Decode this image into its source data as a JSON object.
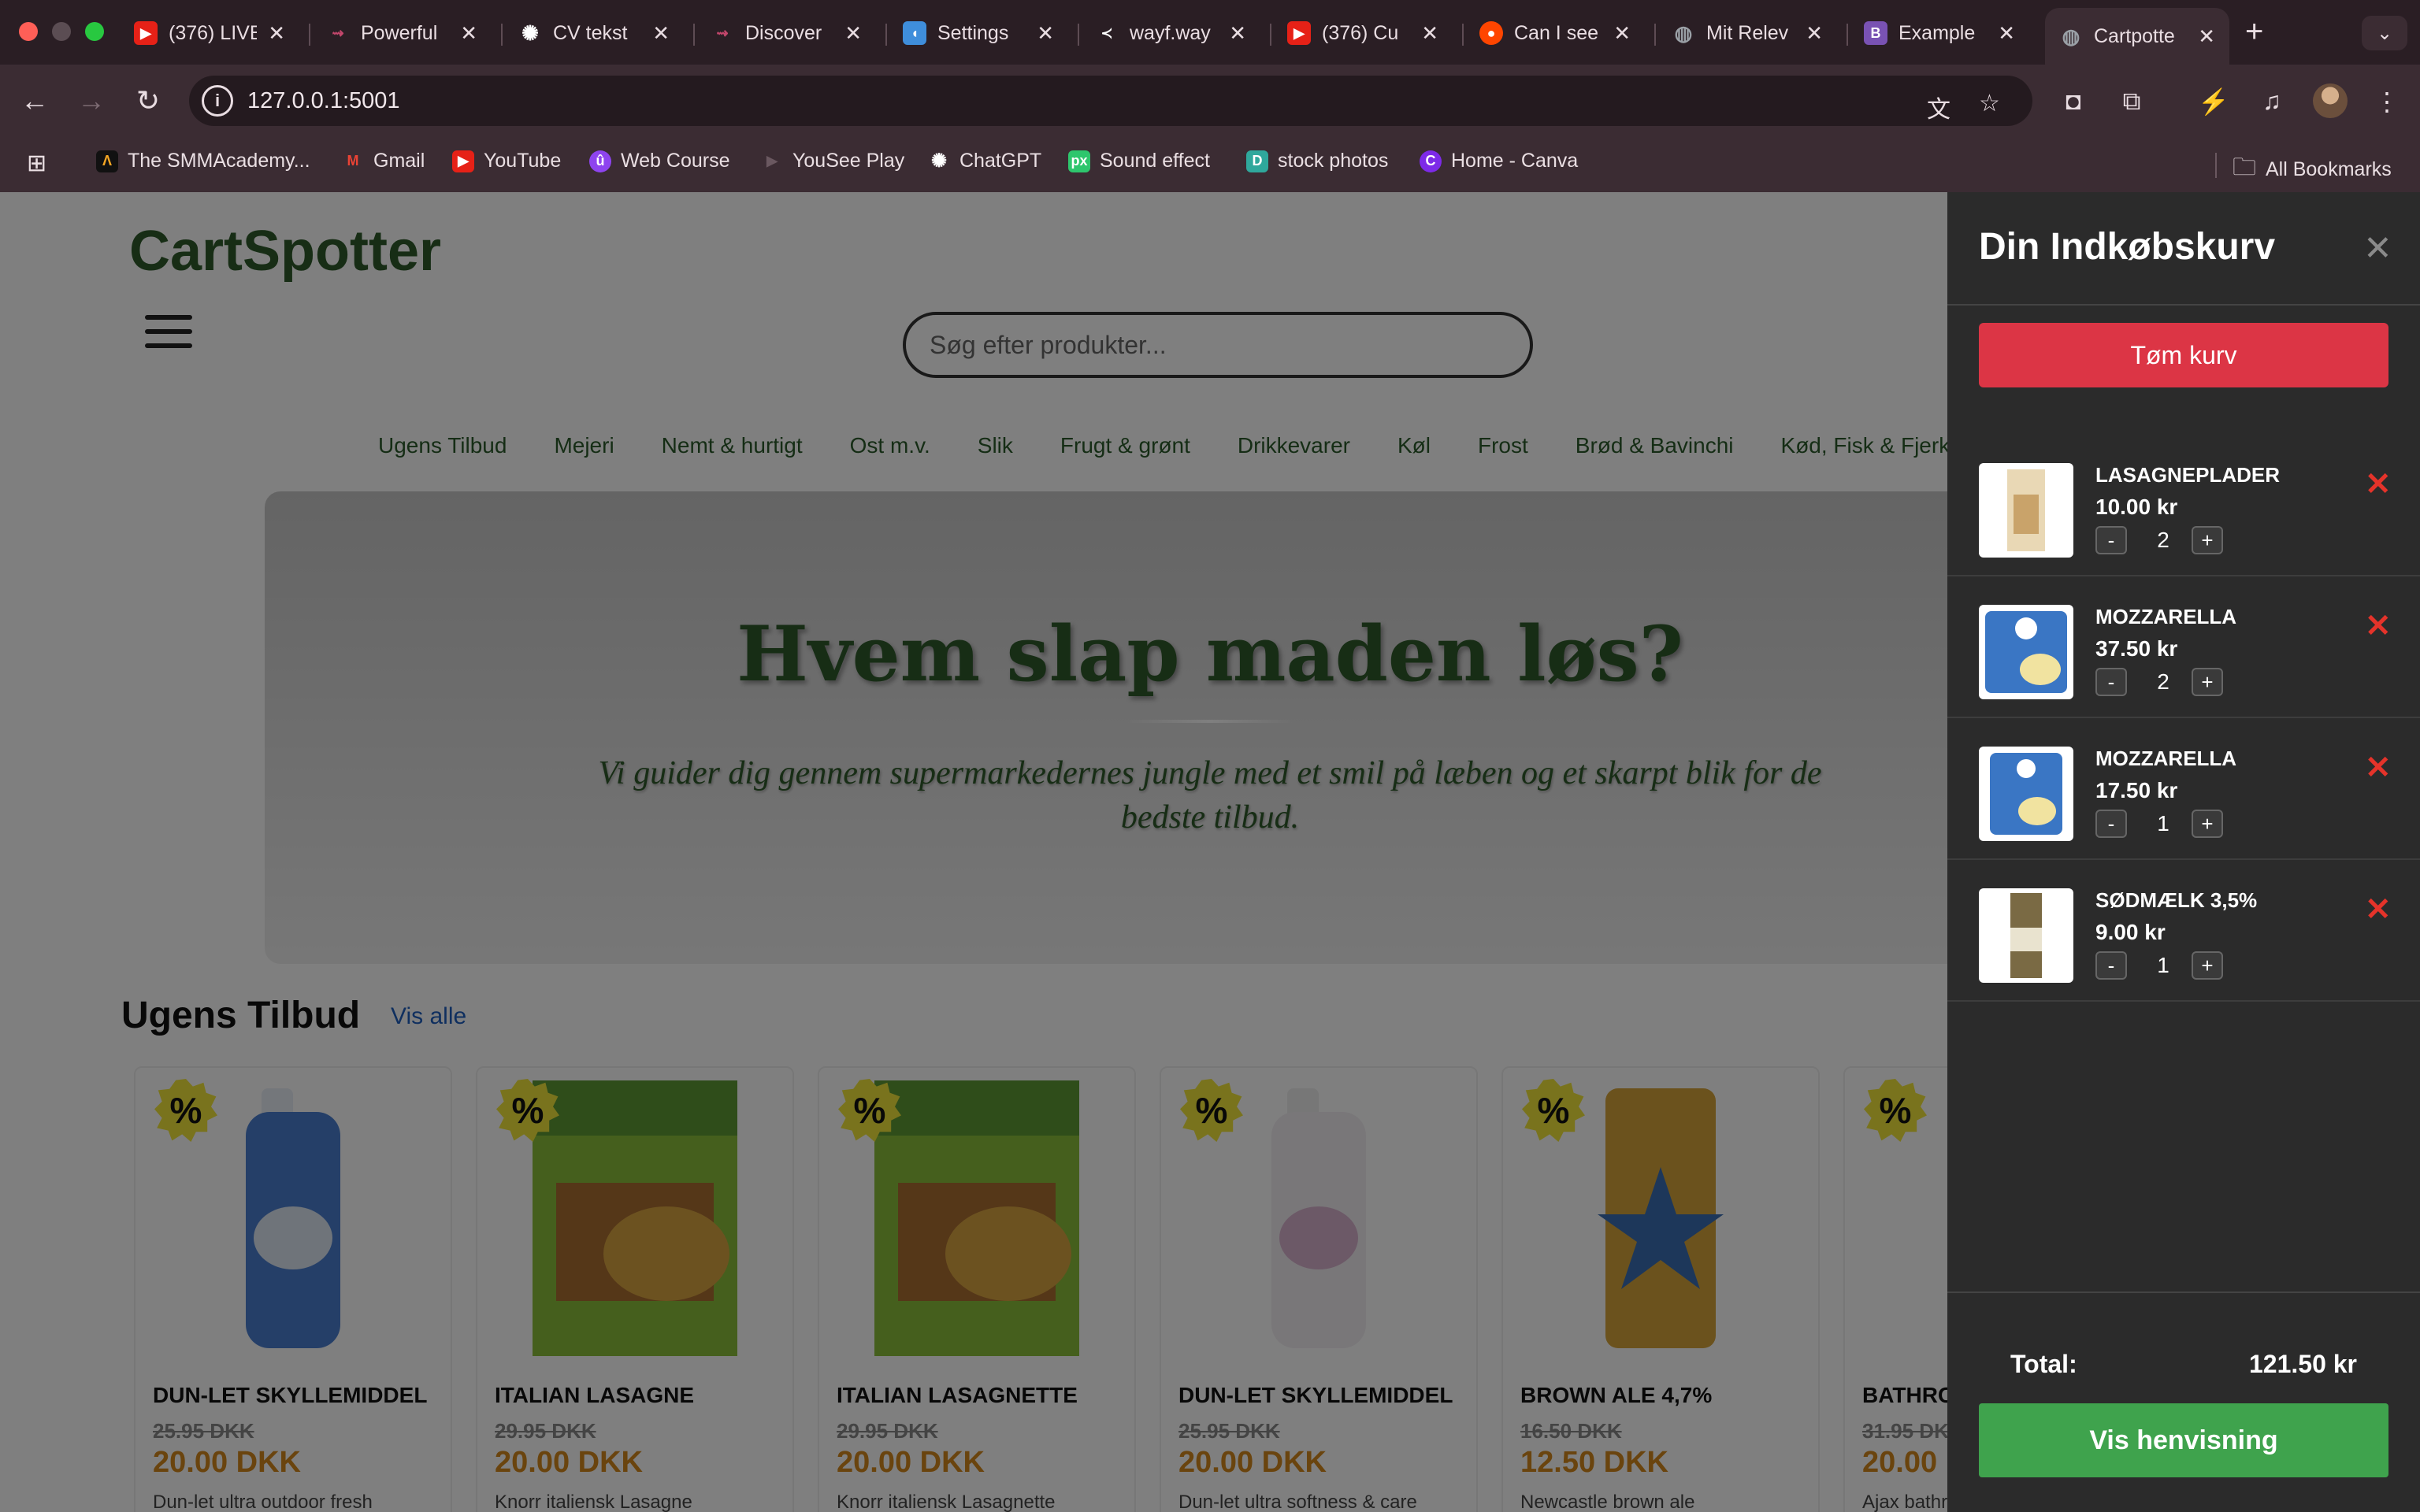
{
  "browser": {
    "tabs": [
      {
        "title": "(376) LIVE",
        "icon": "youtube-icon",
        "color": "#e62117"
      },
      {
        "title": "Powerful",
        "icon": "link-icon",
        "color": "#c2466b"
      },
      {
        "title": "CV tekst",
        "icon": "openai-icon",
        "color": "#ffffff"
      },
      {
        "title": "Discover",
        "icon": "link-icon",
        "color": "#c2466b"
      },
      {
        "title": "Settings",
        "icon": "settings-app-icon",
        "color": "#3f8edb"
      },
      {
        "title": "wayf.way",
        "icon": "wayf-icon",
        "color": "#ffffff"
      },
      {
        "title": "(376) Cu",
        "icon": "youtube-icon",
        "color": "#e62117"
      },
      {
        "title": "Can I see",
        "icon": "reddit-icon",
        "color": "#ff4500"
      },
      {
        "title": "Mit Relev",
        "icon": "globe-icon",
        "color": "#9aa0a6"
      },
      {
        "title": "Example",
        "icon": "bootstrap-icon",
        "color": "#7952b3"
      },
      {
        "title": "Cartpotte",
        "icon": "globe-icon",
        "color": "#9aa0a6",
        "active": true
      }
    ],
    "url": "127.0.0.1:5001",
    "bookmarks": [
      {
        "label": "The SMMAcademy...",
        "icon": "smm-icon",
        "color": "#f5a623"
      },
      {
        "label": "Gmail",
        "icon": "gmail-icon",
        "color": "#ea4335"
      },
      {
        "label": "YouTube",
        "icon": "youtube-icon",
        "color": "#e62117"
      },
      {
        "label": "Web Course",
        "icon": "course-icon",
        "color": "#8e44ef"
      },
      {
        "label": "YouSee Play",
        "icon": "play-icon",
        "color": "#3b2c33"
      },
      {
        "label": "ChatGPT",
        "icon": "openai-icon",
        "color": "#ffffff"
      },
      {
        "label": "Sound effect",
        "icon": "pixabay-icon",
        "color": "#2ec66d"
      },
      {
        "label": "stock photos",
        "icon": "stock-icon",
        "color": "#2fa89c"
      },
      {
        "label": "Home - Canva",
        "icon": "canva-icon",
        "color": "#7d2ae8"
      }
    ],
    "all_bookmarks": "All Bookmarks"
  },
  "site": {
    "brand": "CartSpotter",
    "search_placeholder": "Søg efter produkter...",
    "categories": [
      "Ugens Tilbud",
      "Mejeri",
      "Nemt & hurtigt",
      "Ost m.v.",
      "Slik",
      "Frugt & grønt",
      "Drikkevarer",
      "Køl",
      "Frost",
      "Brød & Bavinchi",
      "Kød, Fisk & Fjerkræ"
    ],
    "hero_title": "Hvem slap maden løs?",
    "hero_subtitle": "Vi guider dig gennem supermarkedernes jungle med et smil på læben og et skarpt blik for de bedste tilbud.",
    "offers_title": "Ugens Tilbud",
    "offers_link": "Vis alle",
    "badge": "%",
    "products": [
      {
        "name": "DUN-LET SKYLLEMIDDEL",
        "old": "25.95 DKK",
        "new": "20.00 DKK",
        "desc": "Dun-let ultra outdoor fresh",
        "color": "#4b7fd1"
      },
      {
        "name": "ITALIAN LASAGNE",
        "old": "29.95 DKK",
        "new": "20.00 DKK",
        "desc": "Knorr italiensk Lasagne",
        "color": "#5e9a34"
      },
      {
        "name": "ITALIAN LASAGNETTE",
        "old": "29.95 DKK",
        "new": "20.00 DKK",
        "desc": "Knorr italiensk Lasagnette",
        "color": "#5e9a34"
      },
      {
        "name": "DUN-LET SKYLLEMIDDEL",
        "old": "25.95 DKK",
        "new": "20.00 DKK",
        "desc": "Dun-let ultra softness & care",
        "color": "#c9a6c2"
      },
      {
        "name": "BROWN ALE 4,7%",
        "old": "16.50 DKK",
        "new": "12.50 DKK",
        "desc": "Newcastle brown ale",
        "color": "#d6a43a"
      },
      {
        "name": "BATHRO",
        "old": "31.95 DKK",
        "new": "20.00 D",
        "desc": "Ajax bathr",
        "color": "#3aa0b8"
      }
    ]
  },
  "cart": {
    "title": "Din Indkøbskurv",
    "empty_label": "Tøm kurv",
    "items": [
      {
        "name": "LASAGNEPLADER",
        "price": "10.00 kr",
        "qty": "2",
        "color": "#c9a36a"
      },
      {
        "name": "MOZZARELLA",
        "price": "37.50 kr",
        "qty": "2",
        "color": "#3a76c4"
      },
      {
        "name": "MOZZARELLA",
        "price": "17.50 kr",
        "qty": "1",
        "color": "#3a76c4"
      },
      {
        "name": "SØDMÆLK 3,5%",
        "price": "9.00 kr",
        "qty": "1",
        "color": "#7a6a44"
      }
    ],
    "minus": "-",
    "plus": "+",
    "remove": "✕",
    "total_label": "Total:",
    "total_value": "121.50 kr",
    "checkout_label": "Vis henvisning"
  }
}
